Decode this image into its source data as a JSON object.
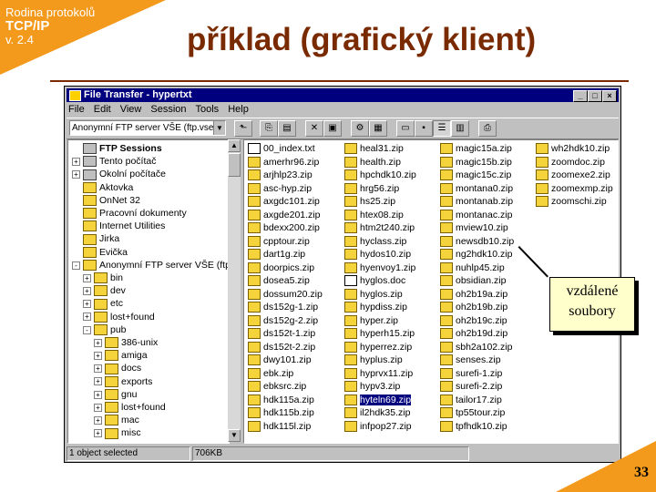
{
  "slide": {
    "course": "Rodina protokolů",
    "protocol": "TCP/IP",
    "version": "v. 2.4",
    "title": "příklad (grafický klient)",
    "page_number": "33",
    "callout_line1": "vzdálené",
    "callout_line2": "soubory",
    "accent_color": "#f39a1d",
    "title_color": "#7a2a00"
  },
  "window": {
    "title": "File Transfer - hypertxt",
    "menu": [
      "File",
      "Edit",
      "View",
      "Session",
      "Tools",
      "Help"
    ],
    "address": "Anonymní FTP server VŠE (ftp.vse",
    "status_left": "1 object selected",
    "status_size": "706KB"
  },
  "tree": [
    {
      "label": "FTP Sessions",
      "icon": "computer",
      "level": 0,
      "bold": true
    },
    {
      "label": "Tento počítač",
      "icon": "computer",
      "level": 0,
      "exp": "+"
    },
    {
      "label": "Okolní počítače",
      "icon": "computer",
      "level": 0,
      "exp": "+"
    },
    {
      "label": "Aktovka",
      "icon": "folder",
      "level": 0
    },
    {
      "label": "OnNet 32",
      "icon": "folder",
      "level": 0
    },
    {
      "label": "Pracovní dokumenty",
      "icon": "folder",
      "level": 0
    },
    {
      "label": "Internet Utilities",
      "icon": "folder",
      "level": 0
    },
    {
      "label": "Jirka",
      "icon": "folder",
      "level": 0
    },
    {
      "label": "Evička",
      "icon": "folder",
      "level": 0
    },
    {
      "label": "Anonymní FTP server VŠE (ftp.",
      "icon": "folder",
      "level": 0,
      "exp": "-"
    },
    {
      "label": "bin",
      "icon": "folder",
      "level": 1,
      "exp": "+"
    },
    {
      "label": "dev",
      "icon": "folder",
      "level": 1,
      "exp": "+"
    },
    {
      "label": "etc",
      "icon": "folder",
      "level": 1,
      "exp": "+"
    },
    {
      "label": "lost+found",
      "icon": "folder",
      "level": 1,
      "exp": "+"
    },
    {
      "label": "pub",
      "icon": "folder",
      "level": 1,
      "exp": "-"
    },
    {
      "label": "386-unix",
      "icon": "folder",
      "level": 2,
      "exp": "+"
    },
    {
      "label": "amiga",
      "icon": "folder",
      "level": 2,
      "exp": "+"
    },
    {
      "label": "docs",
      "icon": "folder",
      "level": 2,
      "exp": "+"
    },
    {
      "label": "exports",
      "icon": "folder",
      "level": 2,
      "exp": "+"
    },
    {
      "label": "gnu",
      "icon": "folder",
      "level": 2,
      "exp": "+"
    },
    {
      "label": "lost+found",
      "icon": "folder",
      "level": 2,
      "exp": "+"
    },
    {
      "label": "mac",
      "icon": "folder",
      "level": 2,
      "exp": "+"
    },
    {
      "label": "misc",
      "icon": "folder",
      "level": 2,
      "exp": "+"
    }
  ],
  "files": [
    [
      "00_index.txt",
      "amerhr96.zip",
      "arjhlp23.zip",
      "asc-hyp.zip",
      "axgdc101.zip",
      "axgde201.zip",
      "bdexx200.zip",
      "cpptour.zip",
      "dart1g.zip",
      "doorpics.zip",
      "dosea5.zip",
      "dossum20.zip",
      "ds152g-1.zip",
      "ds152g-2.zip",
      "ds152t-1.zip",
      "ds152t-2.zip",
      "dwy101.zip",
      "ebk.zip",
      "ebksrc.zip",
      "hdk115a.zip",
      "hdk115b.zip",
      "hdk115l.zip"
    ],
    [
      "heal31.zip",
      "health.zip",
      "hpchdk10.zip",
      "hrg56.zip",
      "hs25.zip",
      "htex08.zip",
      "htm2t240.zip",
      "hyclass.zip",
      "hydos10.zip",
      "hyenvoy1.zip",
      "hyglos.doc",
      "hyglos.zip",
      "hypdiss.zip",
      "hyper.zip",
      "hyperh15.zip",
      "hyperrez.zip",
      "hyplus.zip",
      "hyprvx11.zip",
      "hypv3.zip",
      "hyteln69.zip",
      "il2hdk35.zip",
      "infpop27.zip"
    ],
    [
      "magic15a.zip",
      "magic15b.zip",
      "magic15c.zip",
      "montana0.zip",
      "montanab.zip",
      "montanac.zip",
      "mview10.zip",
      "newsdb10.zip",
      "ng2hdk10.zip",
      "nuhlp45.zip",
      "obsidian.zip",
      "oh2b19a.zip",
      "oh2b19b.zip",
      "oh2b19c.zip",
      "oh2b19d.zip",
      "sbh2a102.zip",
      "senses.zip",
      "surefi-1.zip",
      "surefi-2.zip",
      "tailor17.zip",
      "tp55tour.zip",
      "tpfhdk10.zip"
    ],
    [
      "wh2hdk10.zip",
      "zoomdoc.zip",
      "zoomexe2.zip",
      "zoomexmp.zip",
      "zoomschi.zip"
    ]
  ],
  "selected_file": "hyteln69.zip"
}
